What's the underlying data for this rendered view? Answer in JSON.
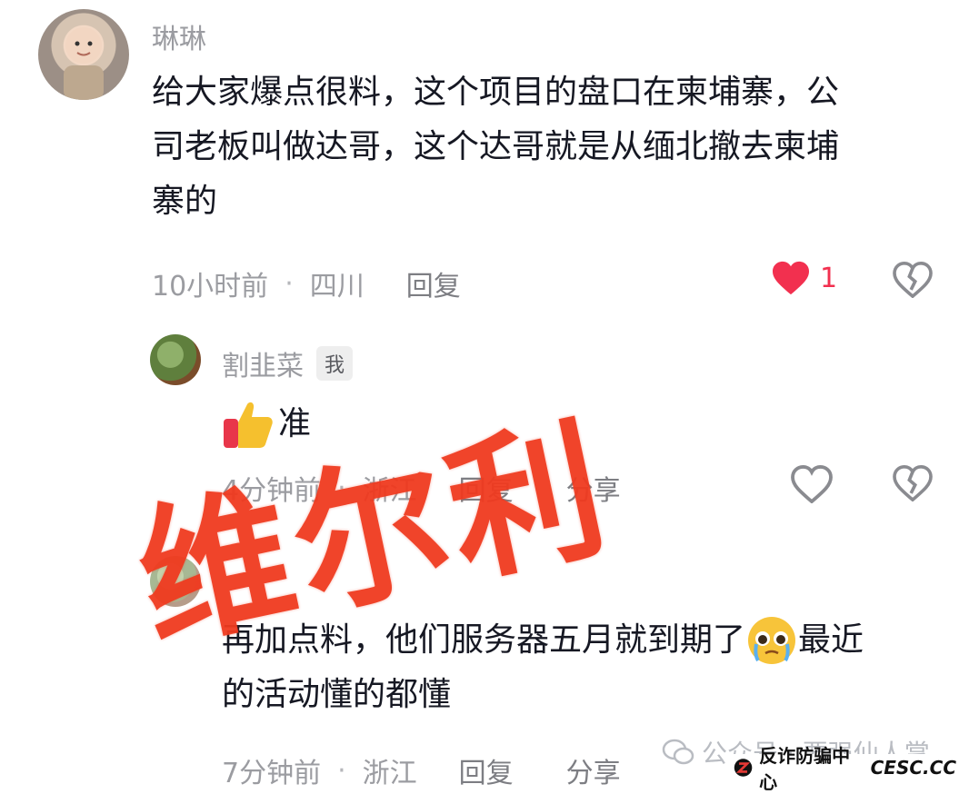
{
  "comment1": {
    "username": "琳琳",
    "lines": [
      "给大家爆点很料，这个项目的盘口在柬埔寨，公",
      "司老板叫做达哥，这个达哥就是从缅北撤去柬埔",
      "寨的"
    ],
    "time": "10小时前",
    "separator": "·",
    "location": "四川",
    "reply_label": "回复",
    "like_count": "1"
  },
  "comment2": {
    "username": "割韭菜",
    "me_badge": "我",
    "text": "准",
    "time": "4分钟前",
    "separator": "·",
    "location": "浙江",
    "reply_label": "回复",
    "share_label": "分享"
  },
  "comment3": {
    "lines_first": "再加点料，他们服务器五月就到期了",
    "lines_first_tail": "最近",
    "lines_second": "的活动懂的都懂",
    "time": "7分钟前",
    "separator": "·",
    "location": "浙江",
    "reply_label": "回复",
    "share_label": "分享"
  },
  "stamp": {
    "text": "维尔利",
    "color": "#f03a1f"
  },
  "watermark": {
    "text": "公众号 · 要强仙人掌"
  },
  "badge": {
    "text": "反诈防骗中心",
    "site": "CESC.CC"
  },
  "colors": {
    "like_red": "#f2304f",
    "meta_gray": "#9b9ca1"
  }
}
